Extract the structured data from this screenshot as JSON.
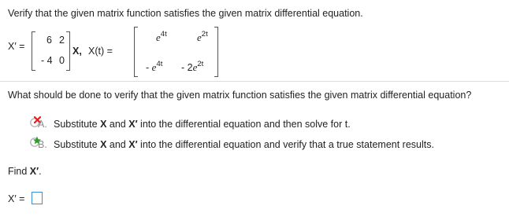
{
  "problem": {
    "prompt": "Verify that the given matrix function satisfies the given matrix differential equation.",
    "equation": {
      "xprime_label": "X′ =",
      "coef_matrix": [
        [
          "6",
          "2"
        ],
        [
          "- 4",
          "0"
        ]
      ],
      "after_matrix": "X,",
      "xt_label": "X(t) =",
      "solution": {
        "r1c1_base": "e",
        "r1c1_exp": "4t",
        "r1c2_base": "e",
        "r1c2_exp": "2t",
        "r2c1_sign": "-",
        "r2c1_base": "e",
        "r2c1_exp": "4t",
        "r2c2_coef": "- 2",
        "r2c2_base": "e",
        "r2c2_exp": "2t"
      }
    }
  },
  "question": {
    "text": "What should be done to verify that the given matrix function satisfies the given matrix differential equation?",
    "choices": [
      {
        "letter": "A.",
        "status": "incorrect",
        "pre": "Substitute ",
        "x": "X",
        "mid": " and ",
        "xp": "X′",
        "post": " into the differential equation and then solve for t."
      },
      {
        "letter": "B.",
        "status": "correct",
        "pre": "Substitute ",
        "x": "X",
        "mid": " and ",
        "xp": "X′",
        "post": " into the differential equation and verify that a true statement results."
      }
    ]
  },
  "find": {
    "pre": "Find ",
    "target": "X′",
    "post": "."
  },
  "answer": {
    "label": "X′ =",
    "value": ""
  },
  "colors": {
    "incorrect": "#e02020",
    "correct": "#2a9d2a",
    "circle": "#b8b8b8",
    "input_border": "#3a8fd6"
  }
}
